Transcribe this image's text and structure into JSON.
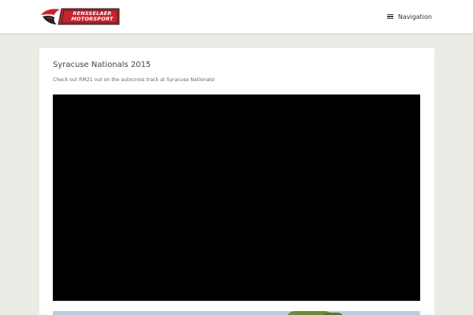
{
  "header": {
    "logo": {
      "line1": "RENSSELAER",
      "line2": "MOTORSPORT",
      "colors": {
        "red": "#c8232c",
        "dark": "#222222"
      }
    },
    "nav_label": "Navigation",
    "nav_icon": "hamburger-menu-icon"
  },
  "post": {
    "title": "Syracuse Nationals 2015",
    "text": "Check out RM21 out on the autocross track at Syracuse Nationals!"
  },
  "colors": {
    "background": "#ebebe6",
    "card": "#ffffff",
    "video": "#000000"
  }
}
